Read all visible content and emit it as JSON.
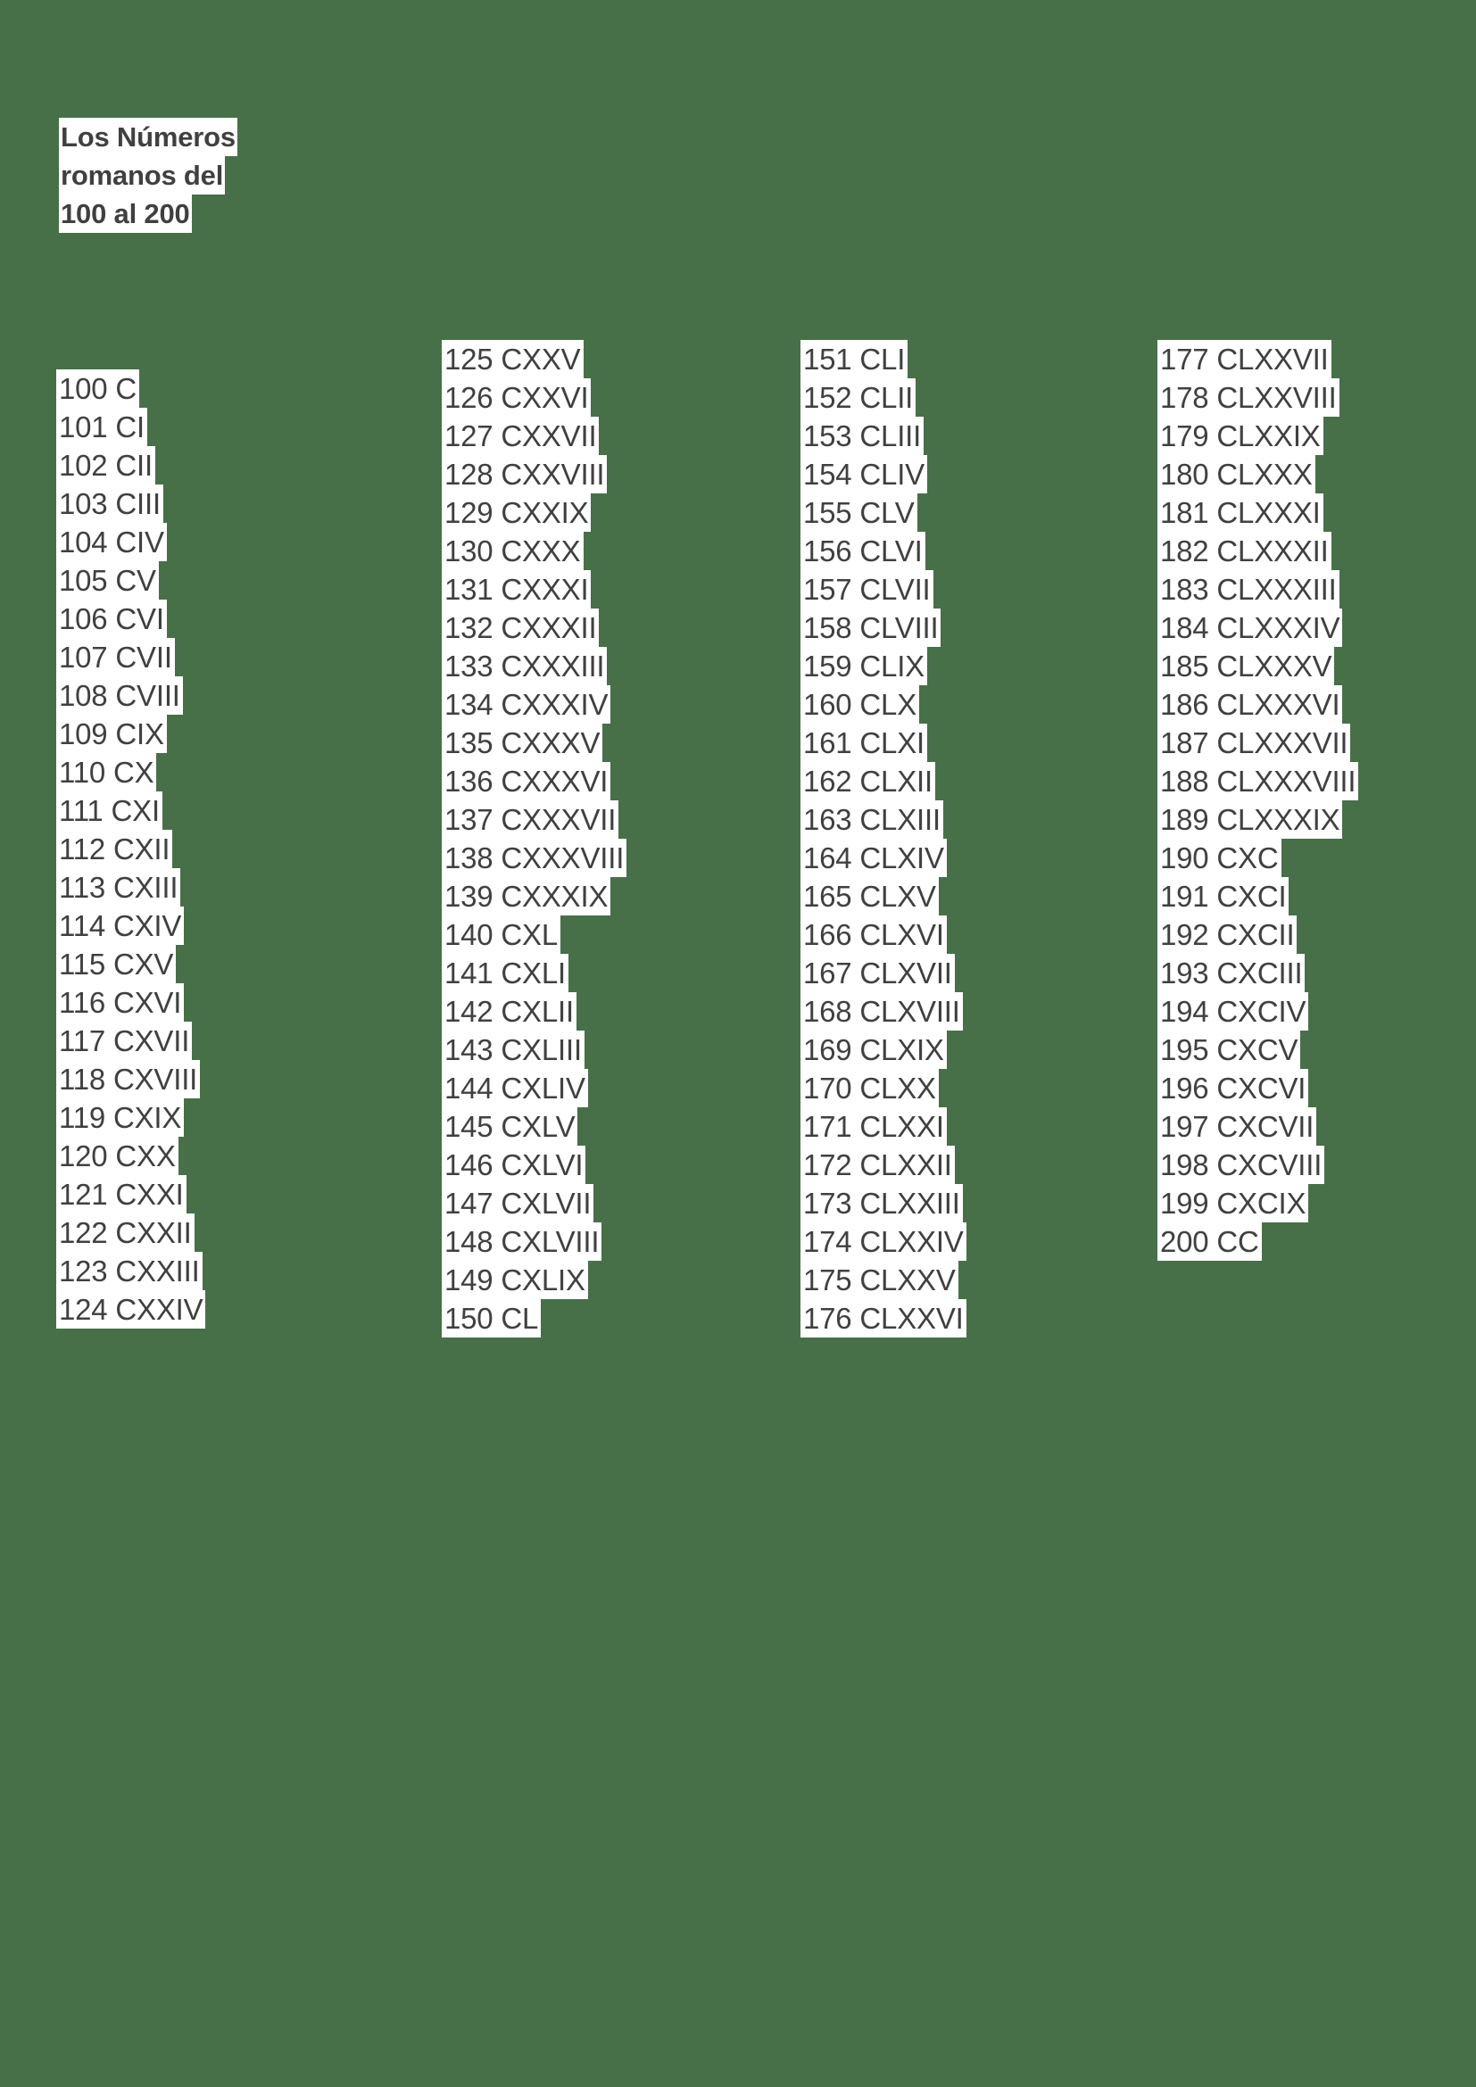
{
  "page": {
    "background_color": "#477049",
    "text_color": "#404040",
    "highlight_color": "#ffffff"
  },
  "title": {
    "full_text": "Los Números romanos del 100 al 200",
    "lines": [
      "Los Números",
      "romanos del",
      "100 al 200"
    ]
  },
  "columns": [
    {
      "name": "column-1",
      "range": "100-124",
      "items": [
        "100 C",
        "101 CI",
        "102 CII",
        "103 CIII",
        "104 CIV",
        "105 CV",
        "106 CVI",
        "107 CVII",
        "108 CVIII",
        "109 CIX",
        "110 CX",
        "111 CXI",
        "112 CXII",
        "113 CXIII",
        "114 CXIV",
        "115 CXV",
        "116 CXVI",
        "117 CXVII",
        "118 CXVIII",
        "119 CXIX",
        "120 CXX",
        "121 CXXI",
        "122 CXXII",
        "123 CXXIII",
        "124 CXXIV"
      ]
    },
    {
      "name": "column-2",
      "range": "125-150",
      "items": [
        "125 CXXV",
        "126 CXXVI",
        "127 CXXVII",
        "128 CXXVIII",
        "129 CXXIX",
        "130 CXXX",
        "131 CXXXI",
        "132 CXXXII",
        "133 CXXXIII",
        "134 CXXXIV",
        "135 CXXXV",
        "136 CXXXVI",
        "137 CXXXVII",
        "138 CXXXVIII",
        "139 CXXXIX",
        "140 CXL",
        "141 CXLI",
        "142 CXLII",
        "143 CXLIII",
        "144 CXLIV",
        "145 CXLV",
        "146 CXLVI",
        "147 CXLVII",
        "148 CXLVIII",
        "149 CXLIX",
        "150 CL"
      ]
    },
    {
      "name": "column-3",
      "range": "151-176",
      "items": [
        "151 CLI",
        "152 CLII",
        "153 CLIII",
        "154 CLIV",
        "155 CLV",
        "156 CLVI",
        "157 CLVII",
        "158 CLVIII",
        "159 CLIX",
        "160 CLX",
        "161 CLXI",
        "162 CLXII",
        "163 CLXIII",
        "164 CLXIV",
        "165 CLXV",
        "166 CLXVI",
        "167 CLXVII",
        "168 CLXVIII",
        "169 CLXIX",
        "170 CLXX",
        "171 CLXXI",
        "172 CLXXII",
        "173 CLXXIII",
        "174 CLXXIV",
        "175 CLXXV",
        "176 CLXXVI"
      ]
    },
    {
      "name": "column-4",
      "range": "177-200",
      "items": [
        "177 CLXXVII",
        "178 CLXXVIII",
        "179 CLXXIX",
        "180 CLXXX",
        "181 CLXXXI",
        "182 CLXXXII",
        "183 CLXXXIII",
        "184 CLXXXIV",
        "185 CLXXXV",
        "186 CLXXXVI",
        "187 CLXXXVII",
        "188 CLXXXVIII",
        "189 CLXXXIX",
        "190 CXC",
        "191 CXCI",
        "192 CXCII",
        "193 CXCIII",
        "194 CXCIV",
        "195 CXCV",
        "196 CXCVI",
        "197 CXCVII",
        "198 CXCVIII",
        "199 CXCIX",
        "200 CC"
      ]
    }
  ]
}
